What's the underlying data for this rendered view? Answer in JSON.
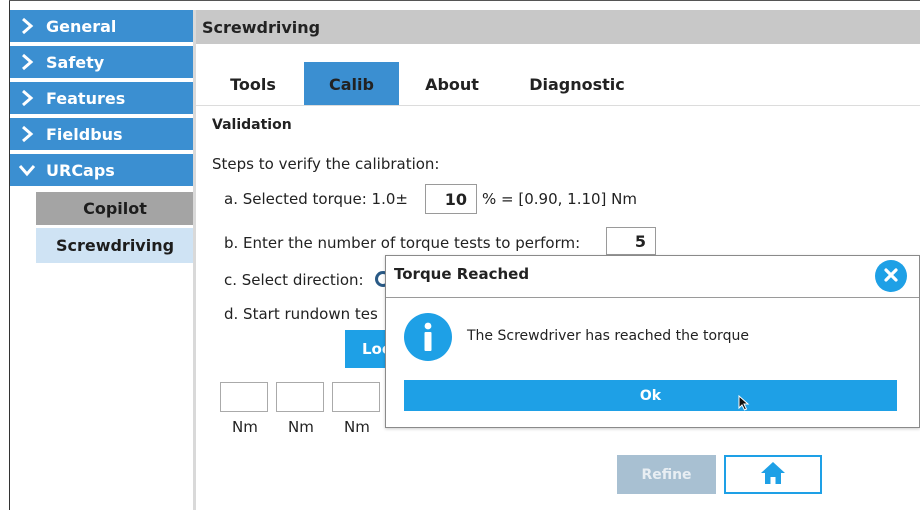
{
  "sidebar": {
    "items": [
      {
        "label": "General",
        "expanded": false
      },
      {
        "label": "Safety",
        "expanded": false
      },
      {
        "label": "Features",
        "expanded": false
      },
      {
        "label": "Fieldbus",
        "expanded": false
      },
      {
        "label": "URCaps",
        "expanded": true
      }
    ],
    "subitems": [
      {
        "label": "Copilot"
      },
      {
        "label": "Screwdriving",
        "selected": true
      }
    ]
  },
  "header": {
    "title": "Screwdriving"
  },
  "tabs": [
    {
      "label": "Tools"
    },
    {
      "label": "Calib",
      "active": true
    },
    {
      "label": "About"
    },
    {
      "label": "Diagnostic"
    }
  ],
  "content": {
    "section_title": "Validation",
    "intro": "Steps to verify the calibration:",
    "step_a_prefix": "a. Selected torque: 1.0±",
    "step_a_value": "10",
    "step_a_suffix": "% = [0.90, 1.10] Nm",
    "step_b_text": "b. Enter the number of torque tests to perform:",
    "step_b_value": "5",
    "step_c_text": "c. Select direction:",
    "step_d_text": "d. Start rundown tes",
    "lock_button_label": "Loc",
    "nm_unit": "Nm",
    "nm_labels": [
      "Nm",
      "Nm",
      "Nm"
    ],
    "refine_label": "Refine",
    "home_icon": "home-icon"
  },
  "dialog": {
    "title": "Torque Reached",
    "message": "The Screwdriver has reached the torque",
    "ok_label": "Ok",
    "info_icon": "info-icon",
    "close_icon": "close-icon"
  },
  "colors": {
    "accent": "#1ea0e6",
    "nav_blue": "#3b8fd1",
    "header_gray": "#c8c8c8",
    "selected_sub": "#cfe3f4",
    "copilot_gray": "#a4a4a4",
    "refine_disabled": "#a8c0d2"
  }
}
